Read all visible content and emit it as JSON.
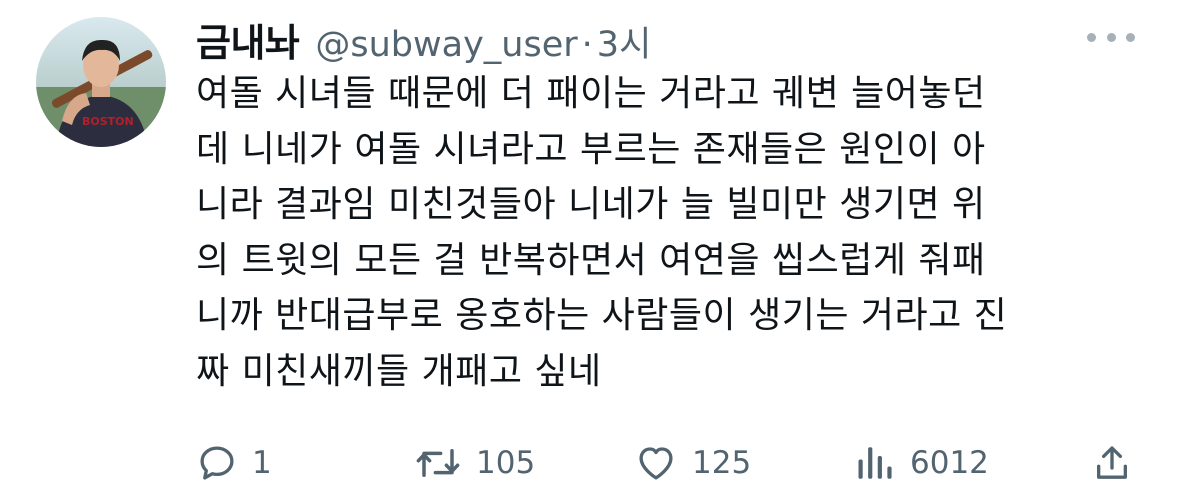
{
  "author": {
    "display_name": "금내놔",
    "handle": "@subway_user",
    "separator": "·",
    "time": "3시"
  },
  "tweet": {
    "text": "여돌 시녀들 때문에 더 패이는 거라고 궤변 늘어놓던\n데 니네가 여돌 시녀라고 부르는 존재들은 원인이 아\n니라 결과임 미친것들아 니네가 늘 빌미만 생기면 위\n의 트윗의 모든 걸 반복하면서 여연을 씹스럽게 줘패\n니까 반대급부로 옹호하는 사람들이 생기는 거라고 진\n짜 미친새끼들 개패고 싶네"
  },
  "actions": {
    "reply_count": "1",
    "retweet_count": "105",
    "like_count": "125",
    "views_count": "6012"
  },
  "icons": {
    "avatar": "avatar-baseball-player",
    "reply": "reply-icon",
    "retweet": "retweet-icon",
    "like": "heart-icon",
    "views": "views-icon",
    "share": "share-icon",
    "more": "more-icon"
  },
  "colors": {
    "text": "#0f1419",
    "secondary": "#536471",
    "background": "#ffffff"
  }
}
